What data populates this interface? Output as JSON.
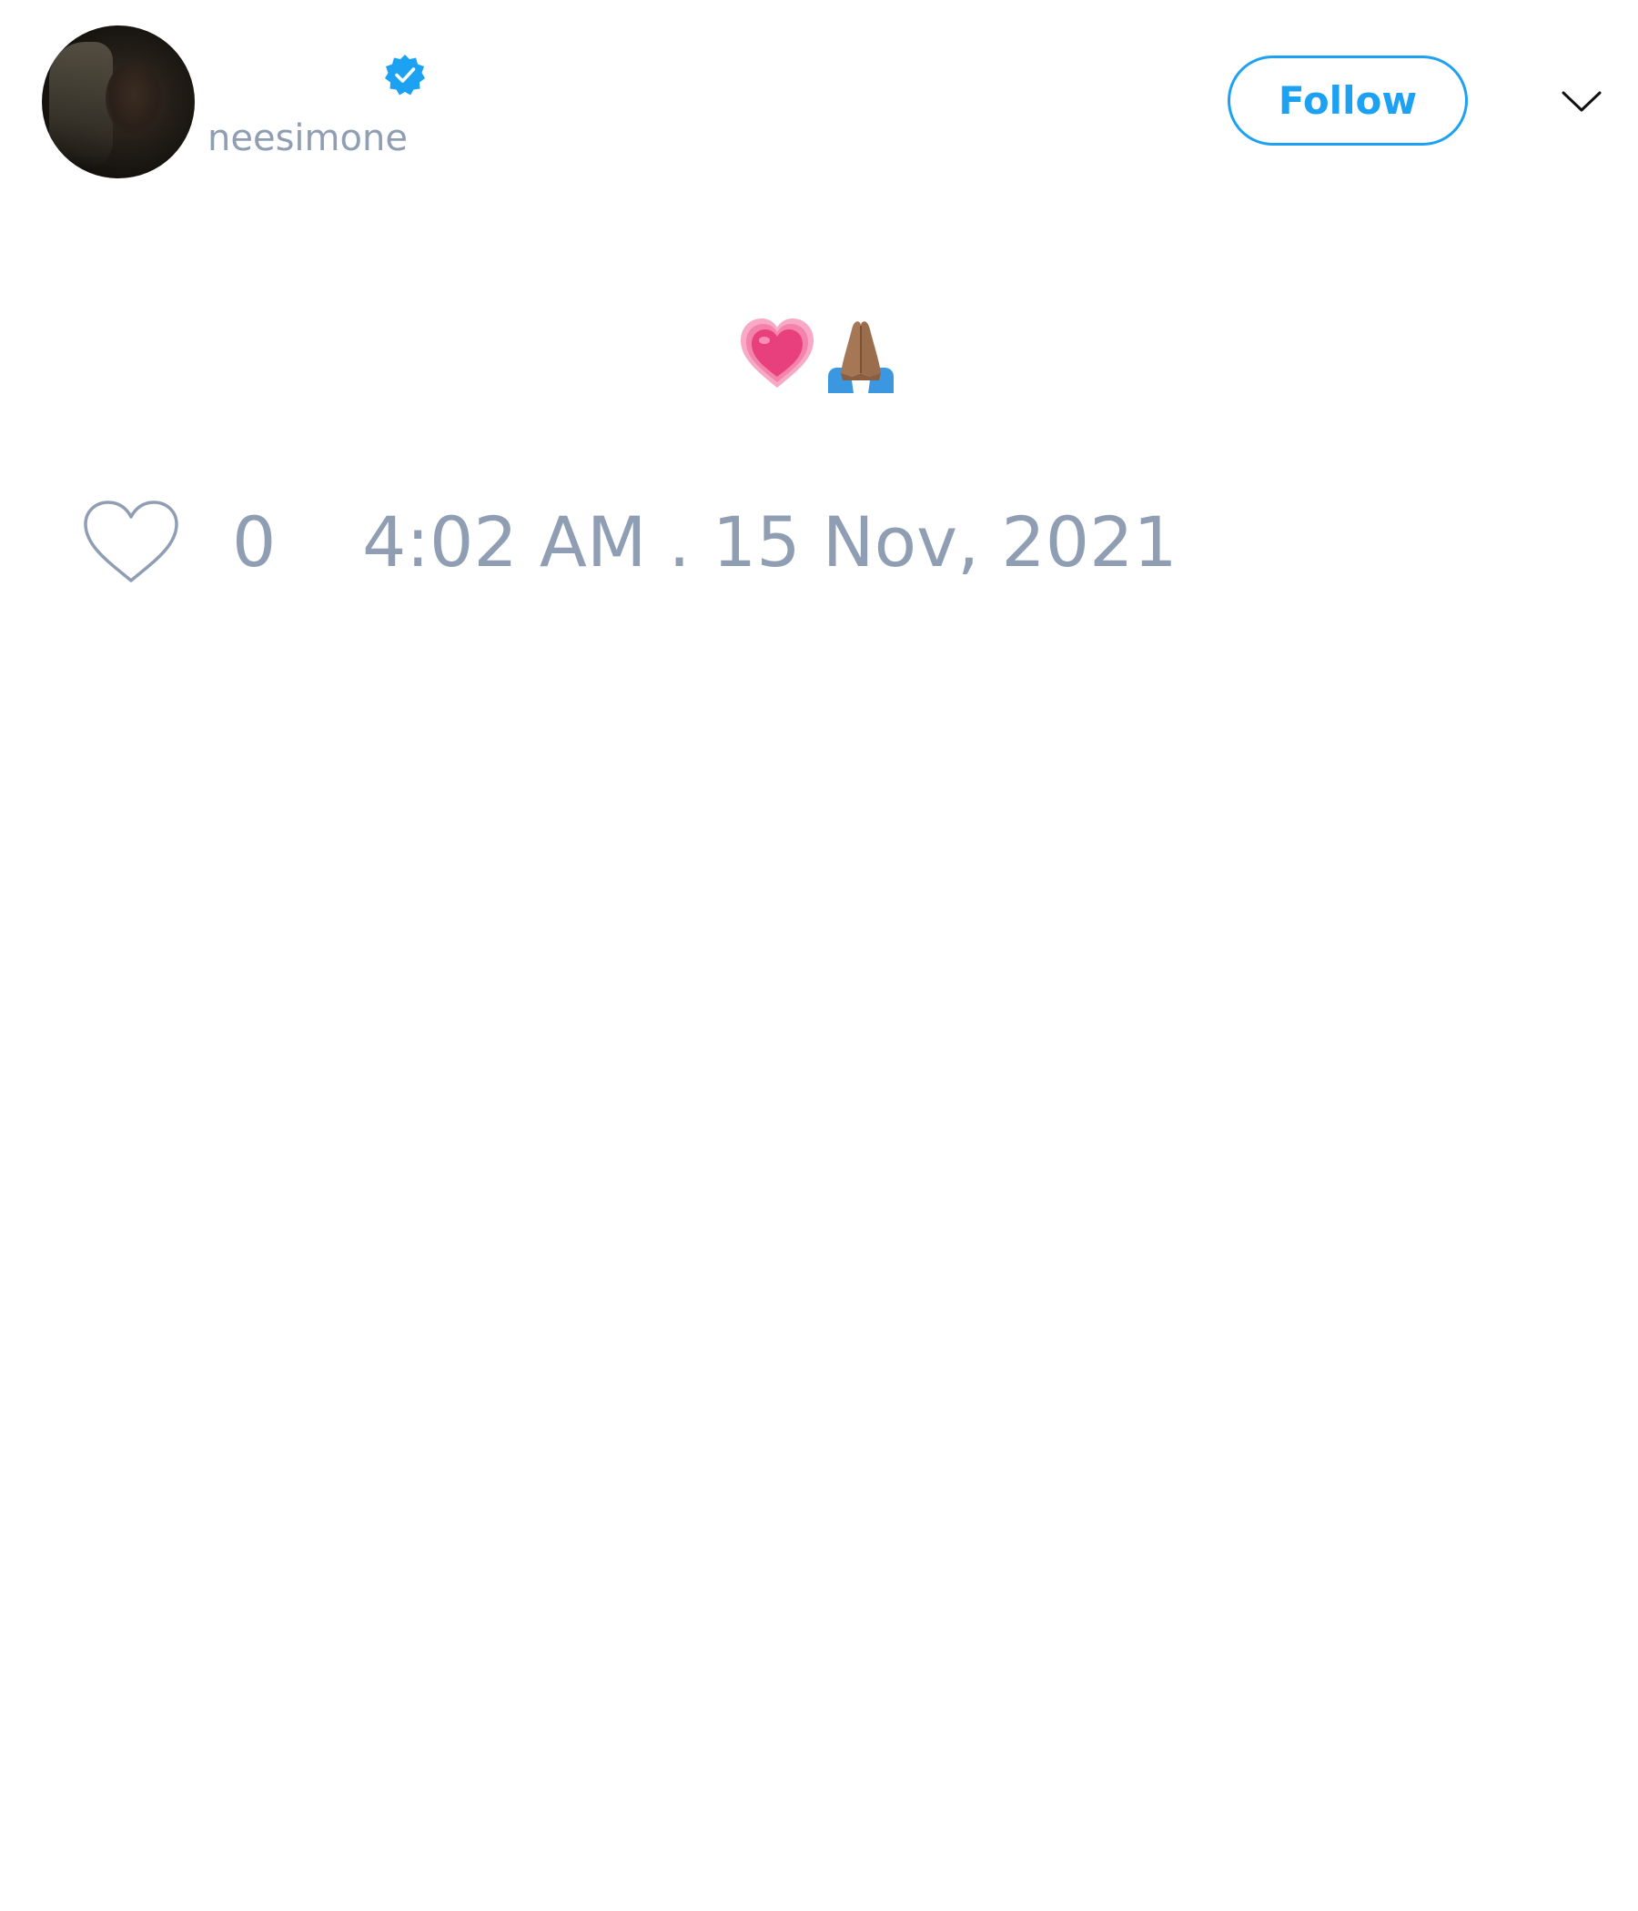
{
  "tweet": {
    "author": {
      "handle": "neesimone",
      "verified": true
    },
    "follow_button": {
      "label": "Follow"
    },
    "text": {
      "emojis": [
        "growing-heart",
        "folded-hands-medium-dark-skin"
      ]
    },
    "likes": {
      "count": "0"
    },
    "timestamp": "4:02 AM . 15 Nov, 2021"
  },
  "colors": {
    "accent": "#1da1f2",
    "muted_text": "#8f9eb3",
    "background": "#ffffff"
  }
}
